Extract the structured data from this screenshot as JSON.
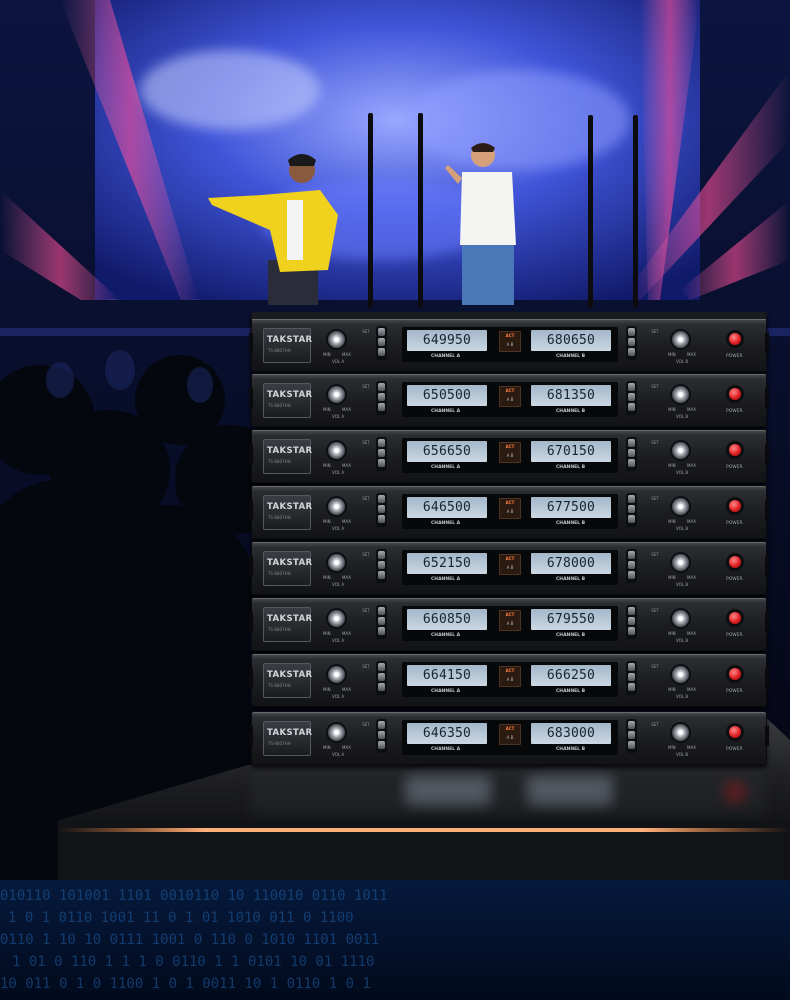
{
  "brand": "TAKSTAR",
  "model": "TS-8807HH",
  "panel_labels": {
    "channel_a": "CHANNEL A",
    "channel_b": "CHANNEL B",
    "act": "ACT",
    "ab": "A    B",
    "vol_a": "VOL A",
    "vol_b": "VOL B",
    "min": "MIN",
    "max": "MAX",
    "set": "SET",
    "power": "POWER"
  },
  "receivers": [
    {
      "channel_a": "649950",
      "channel_b": "680650"
    },
    {
      "channel_a": "650500",
      "channel_b": "681350"
    },
    {
      "channel_a": "656650",
      "channel_b": "670150"
    },
    {
      "channel_a": "646500",
      "channel_b": "677500"
    },
    {
      "channel_a": "652150",
      "channel_b": "678000"
    },
    {
      "channel_a": "660850",
      "channel_b": "679550"
    },
    {
      "channel_a": "664150",
      "channel_b": "666250"
    },
    {
      "channel_a": "646350",
      "channel_b": "683000"
    }
  ],
  "colors": {
    "stage_blue": "#2236a8",
    "beam_pink": "#ff5aa6",
    "lcd_blue": "#b4c6d6",
    "power_red": "#e01f22",
    "edge_orange": "#ff8a3c",
    "binary_blue": "#1f5fa6"
  },
  "icons": [
    "volume-knob-icon",
    "power-button-icon",
    "antenna-icon"
  ]
}
